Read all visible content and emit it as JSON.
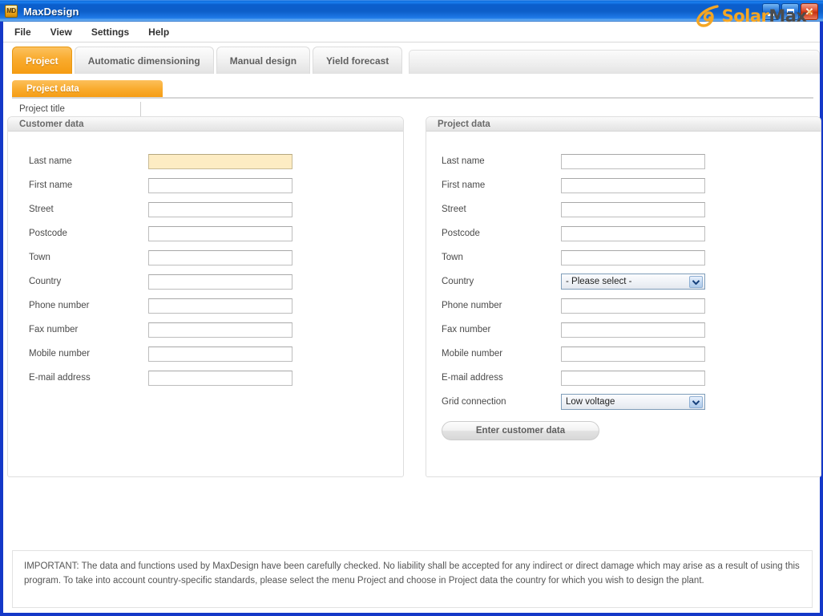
{
  "window": {
    "title": "MaxDesign",
    "icon_label": "MD",
    "icon_name": "maxdesign-app-icon",
    "controls": {
      "minimize": "minimize-icon",
      "maximize": "maximize-icon",
      "close": "close-icon"
    }
  },
  "menubar": {
    "items": [
      "File",
      "View",
      "Settings",
      "Help"
    ]
  },
  "tabs": [
    {
      "label": "Project",
      "active": true
    },
    {
      "label": "Automatic dimensioning",
      "active": false
    },
    {
      "label": "Manual design",
      "active": false
    },
    {
      "label": "Yield forecast",
      "active": false
    }
  ],
  "brand": {
    "name_part1": "Solar",
    "name_part2": "Max",
    "trademark": "®",
    "accent_color": "#f5a623",
    "dark_color": "#4c4c4c"
  },
  "subtab": {
    "label": "Project data"
  },
  "project_title": {
    "label": "Project title",
    "value": "",
    "placeholder": ""
  },
  "customer_panel": {
    "header": "Customer data",
    "fields": [
      {
        "label": "Last name",
        "value": "",
        "type": "text",
        "highlight": true
      },
      {
        "label": "First name",
        "value": "",
        "type": "text",
        "highlight": false
      },
      {
        "label": "Street",
        "value": "",
        "type": "text",
        "highlight": false
      },
      {
        "label": "Postcode",
        "value": "",
        "type": "text",
        "highlight": false
      },
      {
        "label": "Town",
        "value": "",
        "type": "text",
        "highlight": false
      },
      {
        "label": "Country",
        "value": "",
        "type": "text",
        "highlight": false
      },
      {
        "label": "Phone number",
        "value": "",
        "type": "text",
        "highlight": false
      },
      {
        "label": "Fax number",
        "value": "",
        "type": "text",
        "highlight": false
      },
      {
        "label": "Mobile number",
        "value": "",
        "type": "text",
        "highlight": false
      },
      {
        "label": "E-mail address",
        "value": "",
        "type": "text",
        "highlight": false
      }
    ]
  },
  "project_panel": {
    "header": "Project data",
    "fields": [
      {
        "label": "Last name",
        "value": "",
        "type": "text"
      },
      {
        "label": "First name",
        "value": "",
        "type": "text"
      },
      {
        "label": "Street",
        "value": "",
        "type": "text"
      },
      {
        "label": "Postcode",
        "value": "",
        "type": "text"
      },
      {
        "label": "Town",
        "value": "",
        "type": "text"
      },
      {
        "label": "Country",
        "value": "- Please select -",
        "type": "select"
      },
      {
        "label": "Phone number",
        "value": "",
        "type": "text"
      },
      {
        "label": "Fax number",
        "value": "",
        "type": "text"
      },
      {
        "label": "Mobile number",
        "value": "",
        "type": "text"
      },
      {
        "label": "E-mail address",
        "value": "",
        "type": "text"
      },
      {
        "label": "Grid connection",
        "value": "Low voltage",
        "type": "select"
      }
    ],
    "button_label": "Enter customer data"
  },
  "notice": {
    "text": "IMPORTANT: The data and functions used by MaxDesign have been carefully checked. No liability shall be accepted for any indirect or direct damage which may arise as a result of using this program. To take into account country-specific standards, please select the menu Project and choose in Project data the country for which you wish to design the plant."
  }
}
